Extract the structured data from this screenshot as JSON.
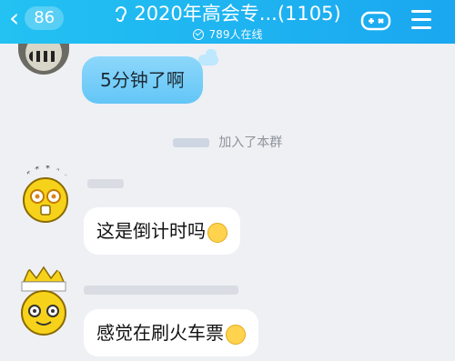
{
  "header": {
    "back_badge": "86",
    "title": "2020年高会专...",
    "member_count": "(1105)",
    "online": "789人在线",
    "colors": {
      "bar": "#1aa7f0",
      "text": "#ffffff"
    }
  },
  "messages": [
    {
      "type": "text",
      "text": "5分钟了啊",
      "style": "blue-bubble"
    },
    {
      "type": "system",
      "text": "加入了本群"
    },
    {
      "type": "text",
      "text": "这是倒计时吗",
      "emoji": "smile-emoji"
    },
    {
      "type": "text",
      "text": "感觉在刷火车票",
      "emoji": "grin-emoji"
    }
  ]
}
